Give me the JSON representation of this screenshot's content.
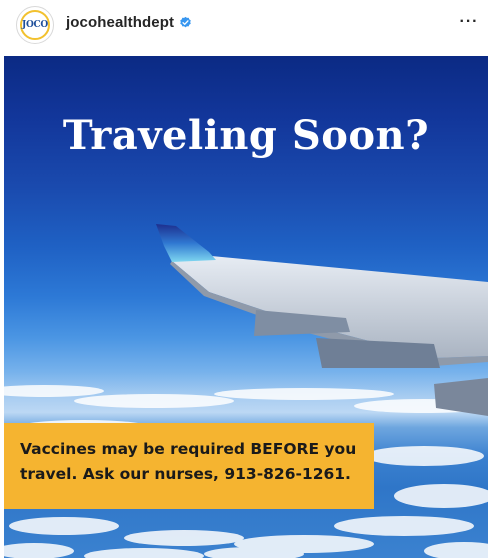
{
  "post": {
    "account": {
      "username": "jocohealthdept",
      "avatar_text": "JOCO",
      "verified": true,
      "verified_icon": "verified-badge-icon",
      "more_icon": "more-options-icon",
      "more_glyph": "···"
    },
    "image": {
      "headline": "Traveling Soon?",
      "caption_line1": "Vaccines may be required BEFORE you",
      "caption_line2": "travel. Ask our nurses, 913-826-1261."
    }
  },
  "colors": {
    "caption_bg": "#f5b430",
    "verified_blue": "#3897f0",
    "sky_top": "#0b2a84",
    "sky_horizon": "#bcd8f4"
  }
}
